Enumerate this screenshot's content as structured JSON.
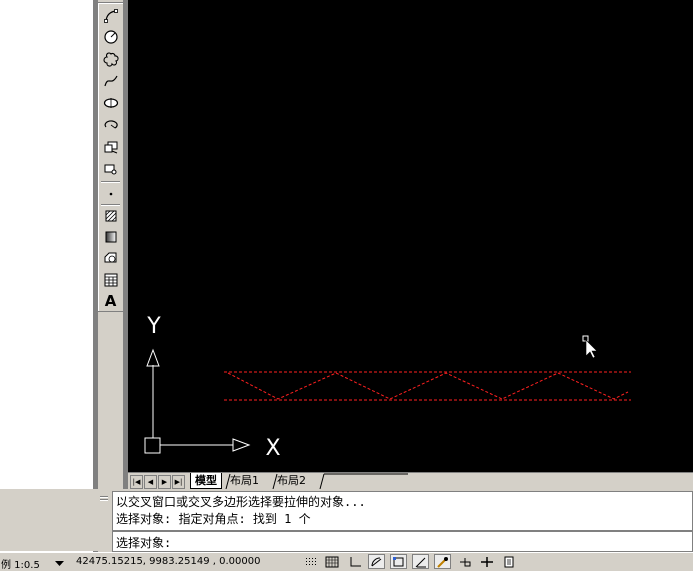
{
  "tabs": {
    "model": "模型",
    "layout1": "布局1",
    "layout2": "布局2"
  },
  "ucs": {
    "x_label": "X",
    "y_label": "Y"
  },
  "command": {
    "line1": "以交叉窗口或交叉多边形选择要拉伸的对象...",
    "line2": "选择对象: 指定对角点: 找到 1 个",
    "prompt": "选择对象:"
  },
  "status": {
    "scale_label": "例 1:0.5",
    "coordinates": "42475.15215, 9983.25149 , 0.00000"
  },
  "toolbar_icons": [
    "arc-icon",
    "circle-icon",
    "revision-cloud-icon",
    "spline-icon",
    "ellipse-icon",
    "ellipse-arc-icon",
    "insert-block-icon",
    "make-block-icon",
    "point-icon",
    "hatch-icon",
    "gradient-icon",
    "region-icon",
    "table-icon",
    "multiline-text-icon"
  ],
  "toolbar_text_label": "A",
  "colors": {
    "canvas_bg": "#000000",
    "selected_object": "#ff2020",
    "ucs_icon": "#ffffff",
    "ui_face": "#d4d0c8"
  }
}
